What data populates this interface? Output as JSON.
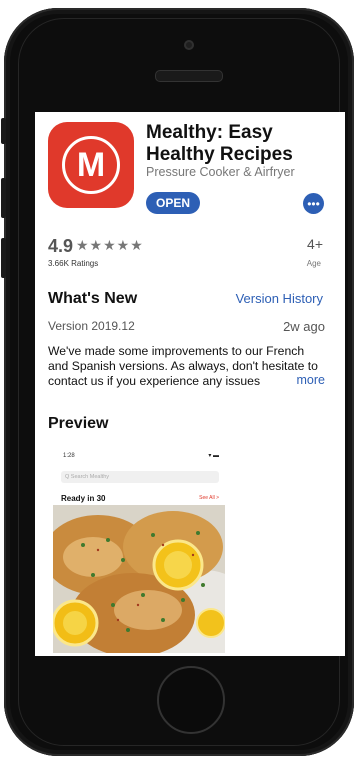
{
  "app": {
    "icon_letter": "M",
    "title": "Mealthy: Easy Healthy Recipes",
    "subtitle": "Pressure Cooker & Airfryer",
    "open_label": "OPEN",
    "more_label": "•••"
  },
  "ratings": {
    "value": "4.9",
    "stars": "★★★★★",
    "count_label": "3.66K Ratings",
    "age_value": "4+",
    "age_label": "Age"
  },
  "whats_new": {
    "heading": "What's New",
    "history_link": "Version History",
    "version": "Version 2019.12",
    "ago": "2w ago",
    "notes": "We've made some improvements to our French and Spanish versions. As always, don't hesitate to contact us if you experience any issues",
    "more_label": "more"
  },
  "preview": {
    "heading": "Preview",
    "shot": {
      "time": "1:28",
      "status": "▾ ▬",
      "search_placeholder": "Q Search Mealthy",
      "section": "Ready in 30",
      "see_all": "See All >"
    }
  },
  "colors": {
    "brand_red": "#e0392b",
    "accent_blue": "#2d5fb5"
  }
}
